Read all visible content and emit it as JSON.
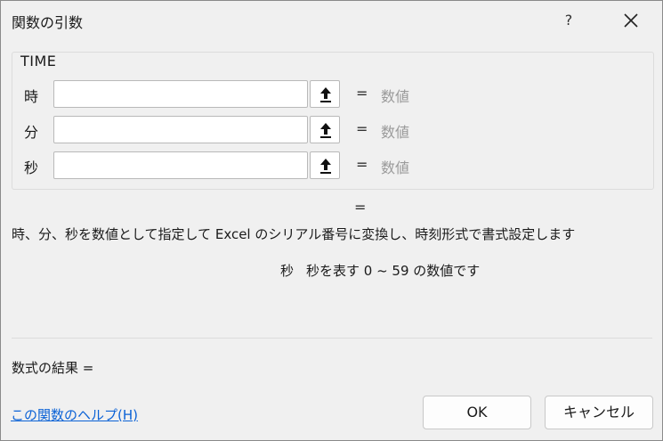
{
  "window": {
    "title": "関数の引数",
    "help_label": "?",
    "close_label": "✕"
  },
  "function": {
    "name": "TIME",
    "args": [
      {
        "label": "時",
        "value": "",
        "result": "数値"
      },
      {
        "label": "分",
        "value": "",
        "result": "数値"
      },
      {
        "label": "秒",
        "value": "",
        "result": "数値"
      }
    ],
    "result_eq": "=",
    "description": "時、分、秒を数値として指定して Excel のシリアル番号に変換し、時刻形式で書式設定します",
    "arg_help_name": "秒",
    "arg_help_text": "秒を表す 0 ~ 59 の数値です"
  },
  "footer": {
    "formula_result_label": "数式の結果 =",
    "help_link": "この関数のヘルプ(H)",
    "ok_label": "OK",
    "cancel_label": "キャンセル"
  },
  "icons": {
    "collapse": "collapse-dialog-arrow-icon",
    "close": "close-icon"
  },
  "colors": {
    "link": "#0b62d6",
    "placeholder_value": "#9a9a9a"
  }
}
